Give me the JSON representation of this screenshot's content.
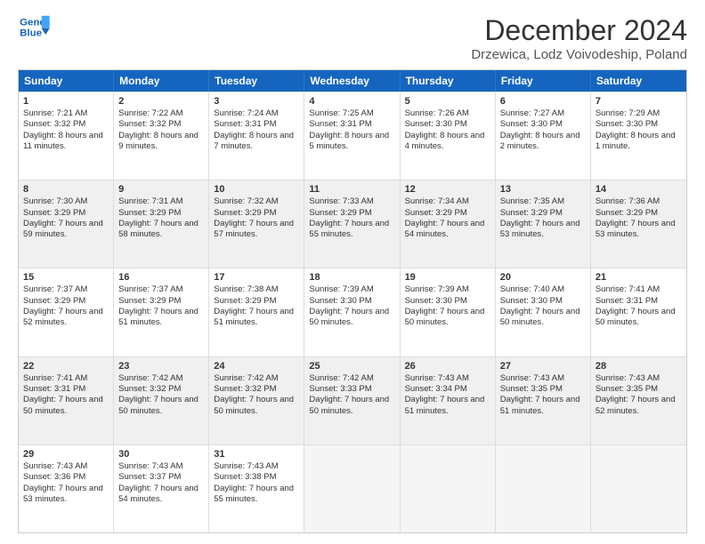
{
  "logo": {
    "line1": "General",
    "line2": "Blue"
  },
  "title": "December 2024",
  "subtitle": "Drzewica, Lodz Voivodeship, Poland",
  "days_header": [
    "Sunday",
    "Monday",
    "Tuesday",
    "Wednesday",
    "Thursday",
    "Friday",
    "Saturday"
  ],
  "weeks": [
    [
      {
        "day": "1",
        "sunrise": "Sunrise: 7:21 AM",
        "sunset": "Sunset: 3:32 PM",
        "daylight": "Daylight: 8 hours and 11 minutes.",
        "empty": false
      },
      {
        "day": "2",
        "sunrise": "Sunrise: 7:22 AM",
        "sunset": "Sunset: 3:32 PM",
        "daylight": "Daylight: 8 hours and 9 minutes.",
        "empty": false
      },
      {
        "day": "3",
        "sunrise": "Sunrise: 7:24 AM",
        "sunset": "Sunset: 3:31 PM",
        "daylight": "Daylight: 8 hours and 7 minutes.",
        "empty": false
      },
      {
        "day": "4",
        "sunrise": "Sunrise: 7:25 AM",
        "sunset": "Sunset: 3:31 PM",
        "daylight": "Daylight: 8 hours and 5 minutes.",
        "empty": false
      },
      {
        "day": "5",
        "sunrise": "Sunrise: 7:26 AM",
        "sunset": "Sunset: 3:30 PM",
        "daylight": "Daylight: 8 hours and 4 minutes.",
        "empty": false
      },
      {
        "day": "6",
        "sunrise": "Sunrise: 7:27 AM",
        "sunset": "Sunset: 3:30 PM",
        "daylight": "Daylight: 8 hours and 2 minutes.",
        "empty": false
      },
      {
        "day": "7",
        "sunrise": "Sunrise: 7:29 AM",
        "sunset": "Sunset: 3:30 PM",
        "daylight": "Daylight: 8 hours and 1 minute.",
        "empty": false
      }
    ],
    [
      {
        "day": "8",
        "sunrise": "Sunrise: 7:30 AM",
        "sunset": "Sunset: 3:29 PM",
        "daylight": "Daylight: 7 hours and 59 minutes.",
        "empty": false,
        "shaded": true
      },
      {
        "day": "9",
        "sunrise": "Sunrise: 7:31 AM",
        "sunset": "Sunset: 3:29 PM",
        "daylight": "Daylight: 7 hours and 58 minutes.",
        "empty": false,
        "shaded": true
      },
      {
        "day": "10",
        "sunrise": "Sunrise: 7:32 AM",
        "sunset": "Sunset: 3:29 PM",
        "daylight": "Daylight: 7 hours and 57 minutes.",
        "empty": false,
        "shaded": true
      },
      {
        "day": "11",
        "sunrise": "Sunrise: 7:33 AM",
        "sunset": "Sunset: 3:29 PM",
        "daylight": "Daylight: 7 hours and 55 minutes.",
        "empty": false,
        "shaded": true
      },
      {
        "day": "12",
        "sunrise": "Sunrise: 7:34 AM",
        "sunset": "Sunset: 3:29 PM",
        "daylight": "Daylight: 7 hours and 54 minutes.",
        "empty": false,
        "shaded": true
      },
      {
        "day": "13",
        "sunrise": "Sunrise: 7:35 AM",
        "sunset": "Sunset: 3:29 PM",
        "daylight": "Daylight: 7 hours and 53 minutes.",
        "empty": false,
        "shaded": true
      },
      {
        "day": "14",
        "sunrise": "Sunrise: 7:36 AM",
        "sunset": "Sunset: 3:29 PM",
        "daylight": "Daylight: 7 hours and 53 minutes.",
        "empty": false,
        "shaded": true
      }
    ],
    [
      {
        "day": "15",
        "sunrise": "Sunrise: 7:37 AM",
        "sunset": "Sunset: 3:29 PM",
        "daylight": "Daylight: 7 hours and 52 minutes.",
        "empty": false
      },
      {
        "day": "16",
        "sunrise": "Sunrise: 7:37 AM",
        "sunset": "Sunset: 3:29 PM",
        "daylight": "Daylight: 7 hours and 51 minutes.",
        "empty": false
      },
      {
        "day": "17",
        "sunrise": "Sunrise: 7:38 AM",
        "sunset": "Sunset: 3:29 PM",
        "daylight": "Daylight: 7 hours and 51 minutes.",
        "empty": false
      },
      {
        "day": "18",
        "sunrise": "Sunrise: 7:39 AM",
        "sunset": "Sunset: 3:30 PM",
        "daylight": "Daylight: 7 hours and 50 minutes.",
        "empty": false
      },
      {
        "day": "19",
        "sunrise": "Sunrise: 7:39 AM",
        "sunset": "Sunset: 3:30 PM",
        "daylight": "Daylight: 7 hours and 50 minutes.",
        "empty": false
      },
      {
        "day": "20",
        "sunrise": "Sunrise: 7:40 AM",
        "sunset": "Sunset: 3:30 PM",
        "daylight": "Daylight: 7 hours and 50 minutes.",
        "empty": false
      },
      {
        "day": "21",
        "sunrise": "Sunrise: 7:41 AM",
        "sunset": "Sunset: 3:31 PM",
        "daylight": "Daylight: 7 hours and 50 minutes.",
        "empty": false
      }
    ],
    [
      {
        "day": "22",
        "sunrise": "Sunrise: 7:41 AM",
        "sunset": "Sunset: 3:31 PM",
        "daylight": "Daylight: 7 hours and 50 minutes.",
        "empty": false,
        "shaded": true
      },
      {
        "day": "23",
        "sunrise": "Sunrise: 7:42 AM",
        "sunset": "Sunset: 3:32 PM",
        "daylight": "Daylight: 7 hours and 50 minutes.",
        "empty": false,
        "shaded": true
      },
      {
        "day": "24",
        "sunrise": "Sunrise: 7:42 AM",
        "sunset": "Sunset: 3:32 PM",
        "daylight": "Daylight: 7 hours and 50 minutes.",
        "empty": false,
        "shaded": true
      },
      {
        "day": "25",
        "sunrise": "Sunrise: 7:42 AM",
        "sunset": "Sunset: 3:33 PM",
        "daylight": "Daylight: 7 hours and 50 minutes.",
        "empty": false,
        "shaded": true
      },
      {
        "day": "26",
        "sunrise": "Sunrise: 7:43 AM",
        "sunset": "Sunset: 3:34 PM",
        "daylight": "Daylight: 7 hours and 51 minutes.",
        "empty": false,
        "shaded": true
      },
      {
        "day": "27",
        "sunrise": "Sunrise: 7:43 AM",
        "sunset": "Sunset: 3:35 PM",
        "daylight": "Daylight: 7 hours and 51 minutes.",
        "empty": false,
        "shaded": true
      },
      {
        "day": "28",
        "sunrise": "Sunrise: 7:43 AM",
        "sunset": "Sunset: 3:35 PM",
        "daylight": "Daylight: 7 hours and 52 minutes.",
        "empty": false,
        "shaded": true
      }
    ],
    [
      {
        "day": "29",
        "sunrise": "Sunrise: 7:43 AM",
        "sunset": "Sunset: 3:36 PM",
        "daylight": "Daylight: 7 hours and 53 minutes.",
        "empty": false
      },
      {
        "day": "30",
        "sunrise": "Sunrise: 7:43 AM",
        "sunset": "Sunset: 3:37 PM",
        "daylight": "Daylight: 7 hours and 54 minutes.",
        "empty": false
      },
      {
        "day": "31",
        "sunrise": "Sunrise: 7:43 AM",
        "sunset": "Sunset: 3:38 PM",
        "daylight": "Daylight: 7 hours and 55 minutes.",
        "empty": false
      },
      {
        "day": "",
        "sunrise": "",
        "sunset": "",
        "daylight": "",
        "empty": true
      },
      {
        "day": "",
        "sunrise": "",
        "sunset": "",
        "daylight": "",
        "empty": true
      },
      {
        "day": "",
        "sunrise": "",
        "sunset": "",
        "daylight": "",
        "empty": true
      },
      {
        "day": "",
        "sunrise": "",
        "sunset": "",
        "daylight": "",
        "empty": true
      }
    ]
  ]
}
